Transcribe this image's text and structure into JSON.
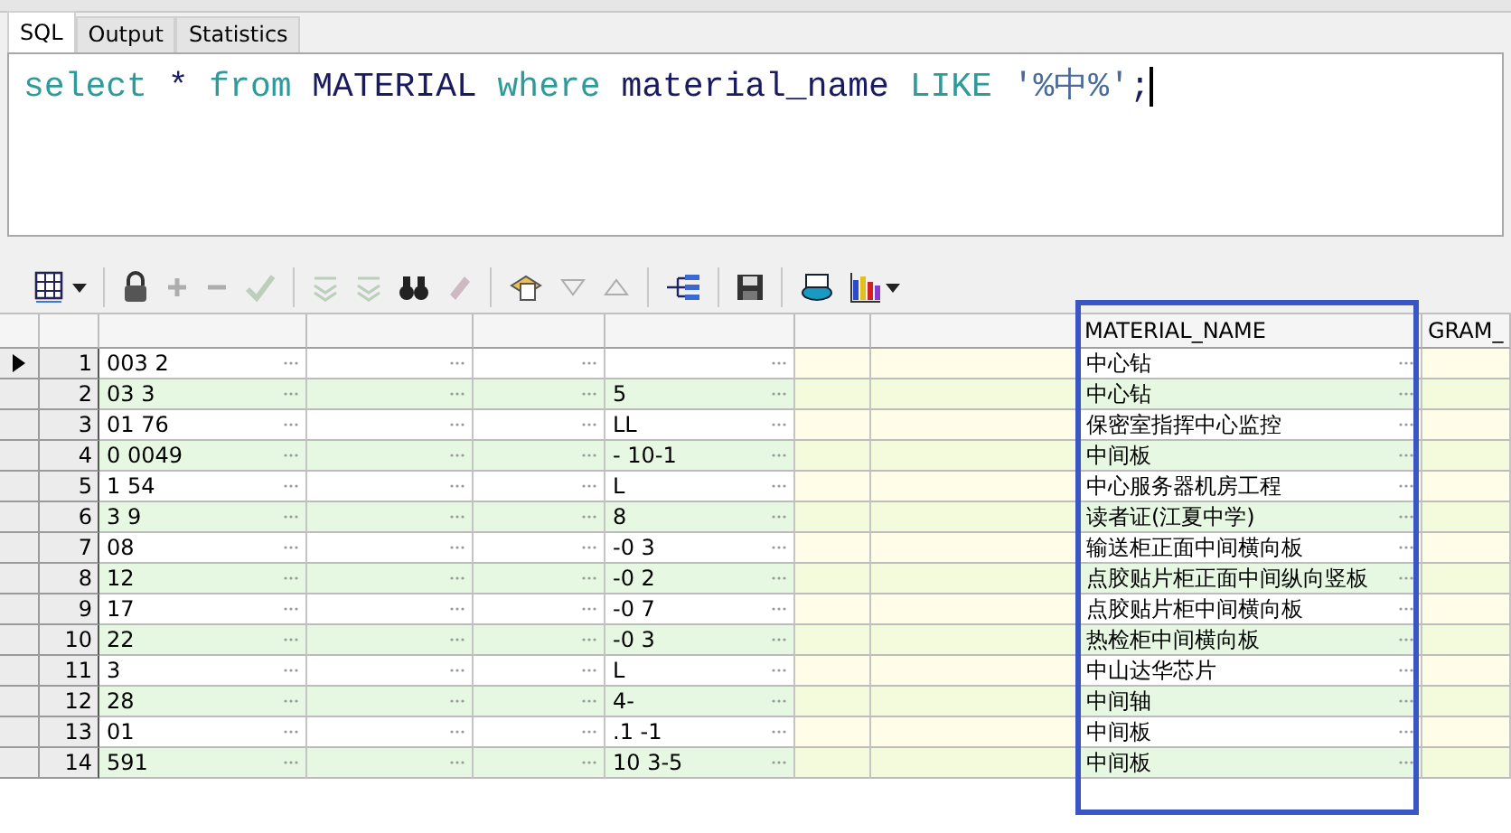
{
  "tabs": [
    {
      "label": "SQL",
      "selected": true
    },
    {
      "label": "Output",
      "selected": false
    },
    {
      "label": "Statistics",
      "selected": false
    }
  ],
  "editor": {
    "tokens": [
      {
        "text": "select",
        "kind": "keyword"
      },
      {
        "text": "*",
        "kind": "ident"
      },
      {
        "text": "from",
        "kind": "keyword"
      },
      {
        "text": "MATERIAL",
        "kind": "ident"
      },
      {
        "text": "where",
        "kind": "keyword"
      },
      {
        "text": "material_name",
        "kind": "ident"
      },
      {
        "text": "LIKE",
        "kind": "keyword"
      },
      {
        "text": "'%中%'",
        "kind": "string"
      },
      {
        "text": ";",
        "kind": "ident",
        "joined": true
      }
    ],
    "cursor": true
  },
  "toolbar": [
    {
      "kind": "grid",
      "disabled": false,
      "menu": true
    },
    {
      "kind": "sep"
    },
    {
      "kind": "lock",
      "disabled": false
    },
    {
      "kind": "plus",
      "disabled": true
    },
    {
      "kind": "minus",
      "disabled": true
    },
    {
      "kind": "check",
      "disabled": true
    },
    {
      "kind": "sep"
    },
    {
      "kind": "down",
      "disabled": true
    },
    {
      "kind": "down",
      "disabled": true
    },
    {
      "kind": "binoculars",
      "disabled": false
    },
    {
      "kind": "eraser",
      "disabled": true
    },
    {
      "kind": "sep"
    },
    {
      "kind": "query",
      "disabled": false
    },
    {
      "kind": "tri-down",
      "disabled": true
    },
    {
      "kind": "tri-up",
      "disabled": true
    },
    {
      "kind": "sep"
    },
    {
      "kind": "tree",
      "disabled": false
    },
    {
      "kind": "sep"
    },
    {
      "kind": "save",
      "disabled": false
    },
    {
      "kind": "sep"
    },
    {
      "kind": "database",
      "disabled": false
    },
    {
      "kind": "chart",
      "disabled": false,
      "menu": true
    }
  ],
  "grid": {
    "columns": [
      {
        "dots": true,
        "kind": "plain"
      },
      {
        "dots": true,
        "kind": "plain"
      },
      {
        "dots": true,
        "kind": "plain"
      },
      {
        "dots": true,
        "kind": "plain"
      },
      {
        "dots": false,
        "kind": "tinted"
      },
      {
        "dots": false,
        "kind": "tinted"
      },
      {
        "header": "MATERIAL_NAME",
        "dots": true,
        "kind": "plain",
        "highlighted": true
      },
      {
        "header": "GRAM_",
        "dots": false,
        "kind": "tinted"
      }
    ],
    "rows": [
      {
        "number": "1",
        "current": true,
        "cells": [
          "003 2",
          "",
          "",
          "",
          "",
          "",
          "中心钻",
          ""
        ]
      },
      {
        "number": "2",
        "current": false,
        "cells": [
          "03 3",
          "",
          "",
          "5",
          "",
          "",
          "中心钻",
          ""
        ]
      },
      {
        "number": "3",
        "current": false,
        "cells": [
          "01 76",
          "",
          "",
          "LL",
          "",
          "",
          "保密室指挥中心监控",
          ""
        ]
      },
      {
        "number": "4",
        "current": false,
        "cells": [
          "0 0049",
          "",
          "",
          "- 10-1",
          "",
          "",
          "中间板",
          ""
        ]
      },
      {
        "number": "5",
        "current": false,
        "cells": [
          "1 54",
          "",
          "",
          "L",
          "",
          "",
          "中心服务器机房工程",
          ""
        ]
      },
      {
        "number": "6",
        "current": false,
        "cells": [
          "3 9",
          "",
          "",
          "8",
          "",
          "",
          "读者证(江夏中学)",
          ""
        ]
      },
      {
        "number": "7",
        "current": false,
        "cells": [
          "08",
          "",
          "",
          "-0 3",
          "",
          "",
          "输送柜正面中间横向板",
          ""
        ]
      },
      {
        "number": "8",
        "current": false,
        "cells": [
          "12",
          "",
          "",
          "-0 2",
          "",
          "",
          "点胶贴片柜正面中间纵向竖板",
          ""
        ]
      },
      {
        "number": "9",
        "current": false,
        "cells": [
          "17",
          "",
          "",
          "-0 7",
          "",
          "",
          "点胶贴片柜中间横向板",
          ""
        ]
      },
      {
        "number": "10",
        "current": false,
        "cells": [
          "22",
          "",
          "",
          "-0 3",
          "",
          "",
          "热检柜中间横向板",
          ""
        ]
      },
      {
        "number": "11",
        "current": false,
        "cells": [
          "3",
          "",
          "",
          "L",
          "",
          "",
          "中山达华芯片",
          ""
        ]
      },
      {
        "number": "12",
        "current": false,
        "cells": [
          "28",
          "",
          "",
          "4-",
          "",
          "",
          "中间轴",
          ""
        ]
      },
      {
        "number": "13",
        "current": false,
        "cells": [
          "01",
          "",
          "",
          ".1 -1",
          "",
          "",
          "中间板",
          ""
        ]
      },
      {
        "number": "14",
        "current": false,
        "cells": [
          "591",
          "",
          "",
          "10 3-5",
          "",
          "",
          "中间板",
          ""
        ]
      }
    ]
  }
}
